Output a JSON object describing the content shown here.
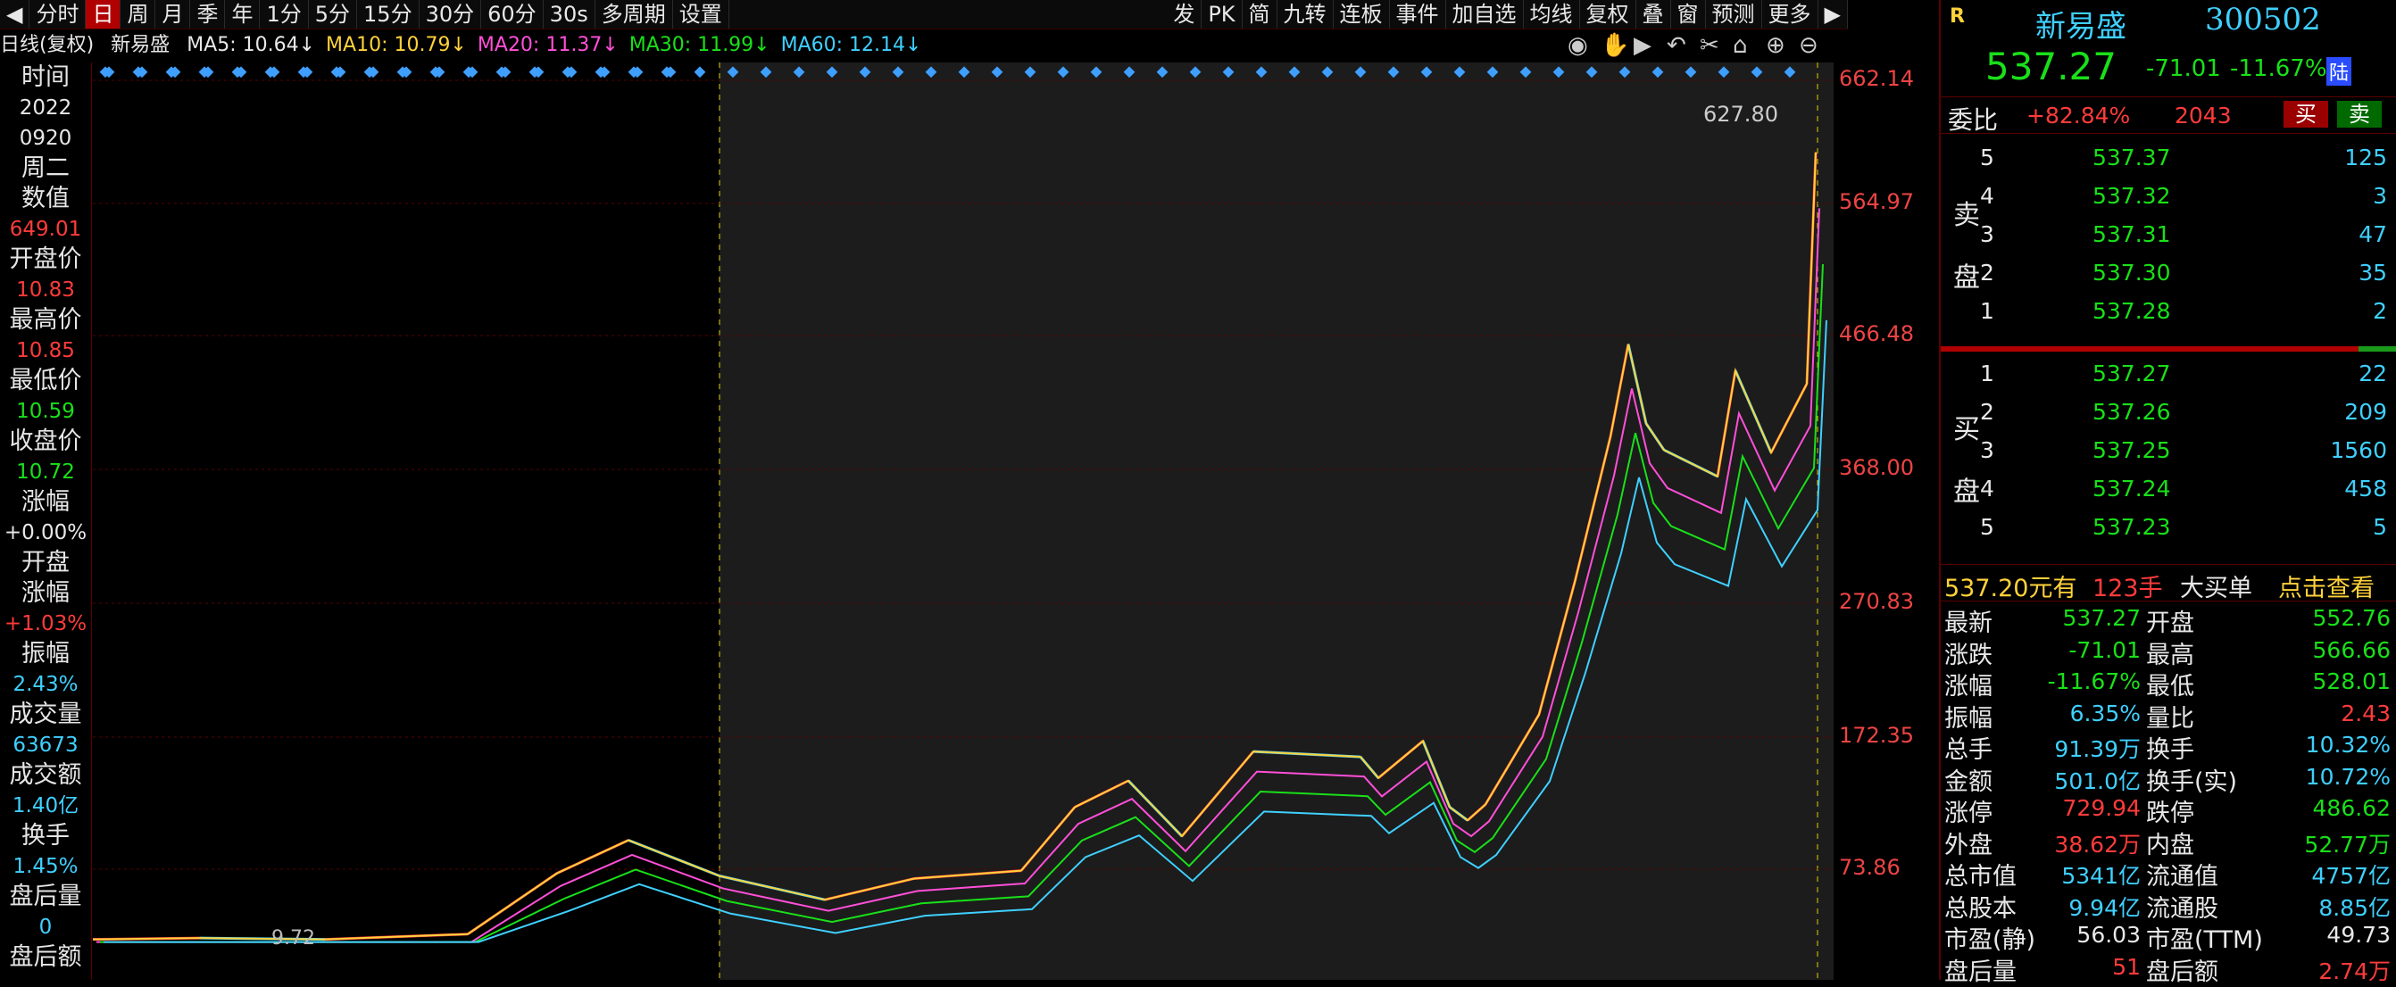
{
  "toolbar": {
    "left": [
      "分时",
      "日",
      "周",
      "月",
      "季",
      "年",
      "1分",
      "5分",
      "15分",
      "30分",
      "60分",
      "30s",
      "多周期",
      "设置"
    ],
    "active": "日",
    "right": [
      "发",
      "PK",
      "简",
      "九转",
      "连板",
      "事件",
      "加自选",
      "均线",
      "复权",
      "叠",
      "窗",
      "预测",
      "更多"
    ]
  },
  "ma_bar": {
    "prefix": "日线(复权)",
    "stock": "新易盛",
    "items": [
      {
        "label": "MA5: 10.64↓",
        "color": "#e8e8e8"
      },
      {
        "label": "MA10: 10.79↓",
        "color": "#ffd23a"
      },
      {
        "label": "MA20: 11.37↓",
        "color": "#ff4fd8"
      },
      {
        "label": "MA30: 11.99↓",
        "color": "#19e019"
      },
      {
        "label": "MA60: 12.14↓",
        "color": "#3fd0ff"
      }
    ]
  },
  "left_info": [
    {
      "label": "时间"
    },
    {
      "value": "2022",
      "color": "#e8e8e8"
    },
    {
      "value": "0920",
      "color": "#e8e8e8"
    },
    {
      "label": "周二"
    },
    {
      "label": "数值"
    },
    {
      "value": "649.01",
      "color": "#ff3b3b"
    },
    {
      "label": "开盘价"
    },
    {
      "value": "10.83",
      "color": "#ff3b3b"
    },
    {
      "label": "最高价"
    },
    {
      "value": "10.85",
      "color": "#ff3b3b"
    },
    {
      "label": "最低价"
    },
    {
      "value": "10.59",
      "color": "#19e019"
    },
    {
      "label": "收盘价"
    },
    {
      "value": "10.72",
      "color": "#19e019"
    },
    {
      "label": "涨幅"
    },
    {
      "value": "+0.00%",
      "color": "#e8e8e8"
    },
    {
      "label": "开盘"
    },
    {
      "label": "涨幅"
    },
    {
      "value": "+1.03%",
      "color": "#ff3b3b"
    },
    {
      "label": "振幅"
    },
    {
      "value": "2.43%",
      "color": "#3fd0ff"
    },
    {
      "label": "成交量"
    },
    {
      "value": "63673",
      "color": "#3fd0ff"
    },
    {
      "label": "成交额"
    },
    {
      "value": "1.40亿",
      "color": "#3fd0ff"
    },
    {
      "label": "换手"
    },
    {
      "value": "1.45%",
      "color": "#3fd0ff"
    },
    {
      "label": "盘后量"
    },
    {
      "value": "0",
      "color": "#3fd0ff"
    },
    {
      "label": "盘后额"
    }
  ],
  "yaxis": [
    "662.14",
    "564.97",
    "466.48",
    "368.00",
    "270.83",
    "172.35",
    "73.86"
  ],
  "chart_labels": {
    "high": "627.80",
    "low": "9.72"
  },
  "header": {
    "badge": "R",
    "name": "新易盛",
    "code": "300502",
    "price": "537.27",
    "change": "-71.01",
    "pct": "-11.67%",
    "market": "陆"
  },
  "weibi": {
    "label": "委比",
    "pct": "+82.84%",
    "diff": "2043",
    "buy": "买",
    "sell": "卖"
  },
  "asks": [
    {
      "lvl": "5",
      "price": "537.37",
      "vol": "125"
    },
    {
      "lvl": "4",
      "price": "537.32",
      "vol": "3"
    },
    {
      "lvl": "3",
      "price": "537.31",
      "vol": "47"
    },
    {
      "lvl": "2",
      "price": "537.30",
      "vol": "35"
    },
    {
      "lvl": "1",
      "price": "537.28",
      "vol": "2"
    }
  ],
  "bids": [
    {
      "lvl": "1",
      "price": "537.27",
      "vol": "22"
    },
    {
      "lvl": "2",
      "price": "537.26",
      "vol": "209"
    },
    {
      "lvl": "3",
      "price": "537.25",
      "vol": "1560"
    },
    {
      "lvl": "4",
      "price": "537.24",
      "vol": "458"
    },
    {
      "lvl": "5",
      "price": "537.23",
      "vol": "5"
    }
  ],
  "sell_label": [
    "卖",
    "盘"
  ],
  "buy_label": [
    "买",
    "盘"
  ],
  "bigorder": {
    "price": "537.20元有",
    "qty": "123手",
    "text": "大买单",
    "link": "点击查看"
  },
  "quote": [
    [
      "最新",
      "537.27",
      "#19e019",
      "开盘",
      "552.76",
      "#19e019"
    ],
    [
      "涨跌",
      "-71.01",
      "#19e019",
      "最高",
      "566.66",
      "#19e019"
    ],
    [
      "涨幅",
      "-11.67%",
      "#19e019",
      "最低",
      "528.01",
      "#19e019"
    ],
    [
      "振幅",
      "6.35%",
      "#3fd0ff",
      "量比",
      "2.43",
      "#ff3b3b"
    ],
    [
      "总手",
      "91.39万",
      "#3fd0ff",
      "换手",
      "10.32%",
      "#3fd0ff"
    ],
    [
      "金额",
      "501.0亿",
      "#3fd0ff",
      "换手(实)",
      "10.72%",
      "#3fd0ff"
    ],
    [
      "涨停",
      "729.94",
      "#ff3b3b",
      "跌停",
      "486.62",
      "#19e019"
    ],
    [
      "外盘",
      "38.62万",
      "#ff3b3b",
      "内盘",
      "52.77万",
      "#19e019"
    ],
    [
      "总市值",
      "5341亿",
      "#3fd0ff",
      "流通值",
      "4757亿",
      "#3fd0ff"
    ],
    [
      "总股本",
      "9.94亿",
      "#3fd0ff",
      "流通股",
      "8.85亿",
      "#3fd0ff"
    ],
    [
      "市盈(静)",
      "56.03",
      "#e8e8e8",
      "市盈(TTM)",
      "49.73",
      "#e8e8e8"
    ],
    [
      "盘后量",
      "51",
      "#ff3b3b",
      "盘后额",
      "2.74万",
      "#ff3b3b"
    ]
  ]
}
